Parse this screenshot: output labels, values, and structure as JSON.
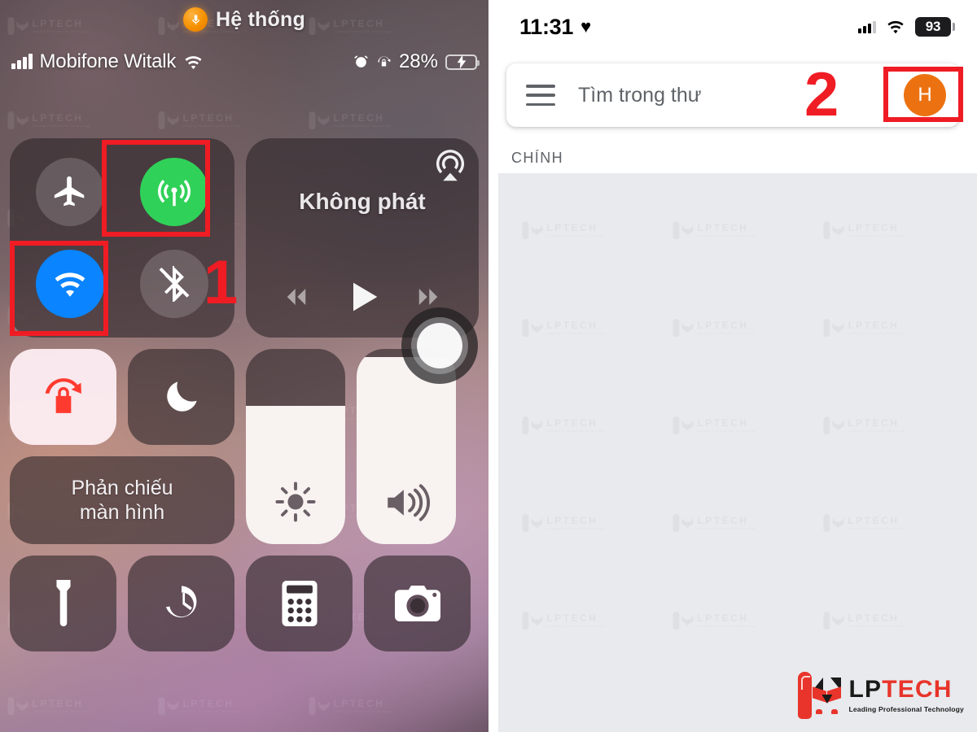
{
  "left_panel": {
    "siri": {
      "mic_icon": "microphone-icon",
      "label": "Hệ thống"
    },
    "status_bar": {
      "signal_icon": "cellular-signal-icon",
      "carrier": "Mobifone Witalk",
      "wifi_icon": "wifi-icon",
      "alarm_icon": "alarm-clock-icon",
      "rotation_lock_icon": "rotation-lock-icon",
      "battery_percent": "28%",
      "battery_charging_icon": "battery-charging-bolt-icon",
      "battery_level": 28,
      "battery_color": "#34c759"
    },
    "connectivity": {
      "airplane": {
        "icon": "airplane-icon",
        "name": "Chế độ máy bay",
        "active": false
      },
      "cellular": {
        "icon": "cellular-data-icon",
        "name": "Dữ liệu di động",
        "active": true,
        "color": "#30d158"
      },
      "wifi": {
        "icon": "wifi-icon",
        "name": "Wi-Fi",
        "active": true,
        "color": "#0a84ff"
      },
      "bluetooth": {
        "icon": "bluetooth-off-icon",
        "name": "Bluetooth",
        "active": false
      }
    },
    "media": {
      "airplay_icon": "airplay-icon",
      "title": "Không phát",
      "prev_icon": "rewind-icon",
      "play_icon": "play-icon",
      "next_icon": "fast-forward-icon"
    },
    "tiles": {
      "rotation_lock": {
        "icon": "rotation-lock-icon",
        "active": true,
        "color": "#ff3b30"
      },
      "do_not_disturb": {
        "icon": "moon-icon",
        "active": false
      },
      "screen_mirror_label": "Phản chiếu\nmàn hình",
      "screen_mirror_line1": "Phản chiếu",
      "screen_mirror_line2": "màn hình"
    },
    "sliders": {
      "brightness": {
        "icon": "brightness-sun-icon",
        "value": 71
      },
      "volume": {
        "icon": "volume-up-icon",
        "value": 96
      }
    },
    "shortcuts": [
      {
        "icon": "flashlight-icon",
        "name": "Đèn pin"
      },
      {
        "icon": "timer-icon",
        "name": "Hẹn giờ"
      },
      {
        "icon": "calculator-icon",
        "name": "Máy tính"
      },
      {
        "icon": "camera-icon",
        "name": "Máy ảnh"
      }
    ],
    "assistive_touch_icon": "assistive-touch-icon",
    "annotation": {
      "step_number": "1",
      "highlight_color": "#ef1c24"
    }
  },
  "right_panel": {
    "status_bar": {
      "time": "11:31",
      "heart_icon": "heart-icon",
      "signal_icon": "cellular-signal-icon",
      "wifi_icon": "wifi-icon",
      "battery_percent": "93"
    },
    "search": {
      "menu_icon": "hamburger-menu-icon",
      "placeholder": "Tìm trong thư",
      "value": "",
      "avatar_initial": "H",
      "avatar_color": "#ec7211"
    },
    "section_label": "CHÍNH",
    "annotation": {
      "step_number": "2",
      "highlight_color": "#ef1c24"
    }
  },
  "watermark": {
    "text": "LPTECH",
    "subtext": "Leading Professional Technology"
  },
  "logo": {
    "name_part1": "LP",
    "name_part2": "TECH",
    "tagline": "Leading Professional Technology"
  }
}
